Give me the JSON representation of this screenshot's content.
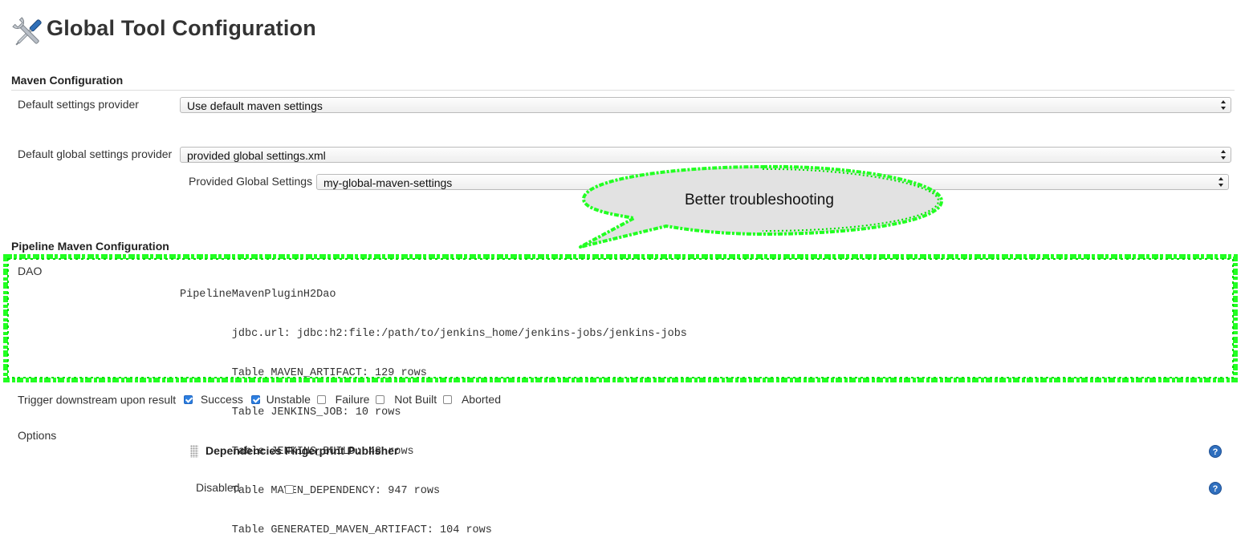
{
  "page": {
    "title": "Global Tool Configuration"
  },
  "maven": {
    "section_title": "Maven Configuration",
    "default_settings_label": "Default settings provider",
    "default_settings_value": "Use default maven settings",
    "global_settings_label": "Default global settings provider",
    "global_settings_value": "provided global settings.xml",
    "provided_global_label": "Provided Global Settings",
    "provided_global_value": "my-global-maven-settings"
  },
  "callout": {
    "text": "Better troubleshooting",
    "color": "#00ff00"
  },
  "pipeline": {
    "section_title": "Pipeline Maven Configuration",
    "dao_label": "DAO",
    "dao_lines": [
      "PipelineMavenPluginH2Dao",
      "        jdbc.url: jdbc:h2:file:/path/to/jenkins_home/jenkins-jobs/jenkins-jobs",
      "        Table MAVEN_ARTIFACT: 129 rows",
      "        Table JENKINS_JOB: 10 rows",
      "        Table JENKINS_BUILD: 48 rows",
      "        Table MAVEN_DEPENDENCY: 947 rows",
      "        Table GENERATED_MAVEN_ARTIFACT: 104 rows"
    ],
    "trigger_label": "Trigger downstream upon result",
    "trigger_options": [
      {
        "label": "Success",
        "checked": true
      },
      {
        "label": "Unstable",
        "checked": true
      },
      {
        "label": "Failure",
        "checked": false
      },
      {
        "label": "Not Built",
        "checked": false
      },
      {
        "label": "Aborted",
        "checked": false
      }
    ],
    "options_label": "Options",
    "publisher_title": "Dependencies Fingerprint Publisher",
    "disabled_label": "Disabled",
    "disabled_checked": false,
    "help_glyph": "?"
  }
}
